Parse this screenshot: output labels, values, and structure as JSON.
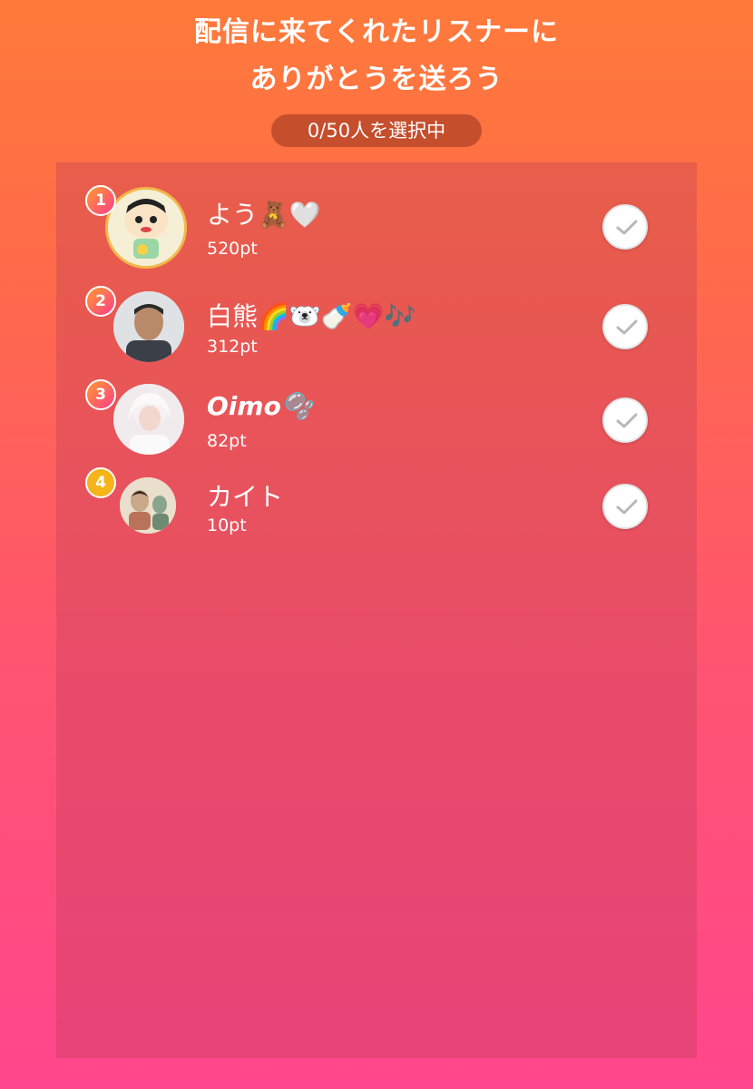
{
  "header": {
    "title_line1": "配信に来てくれたリスナーに",
    "title_line2": "ありがとうを送ろう",
    "selection_counter": "0/50人を選択中"
  },
  "listeners": [
    {
      "rank": "1",
      "name": "よう🧸🤍",
      "points": "520pt"
    },
    {
      "rank": "2",
      "name": "白熊🌈🐻‍❄️🍼💗🎶",
      "points": "312pt"
    },
    {
      "rank": "3",
      "name": "Oimo🫧",
      "points": "82pt"
    },
    {
      "rank": "4",
      "name": "カイト",
      "points": "10pt"
    }
  ],
  "colors": {
    "rank_gradient_start": "#ff9a2e",
    "rank_gradient_end": "#ff3d8b",
    "rank4": "#f4b41a",
    "check_mark": "#b8b8b8"
  },
  "icons": {
    "select": "check-icon"
  }
}
